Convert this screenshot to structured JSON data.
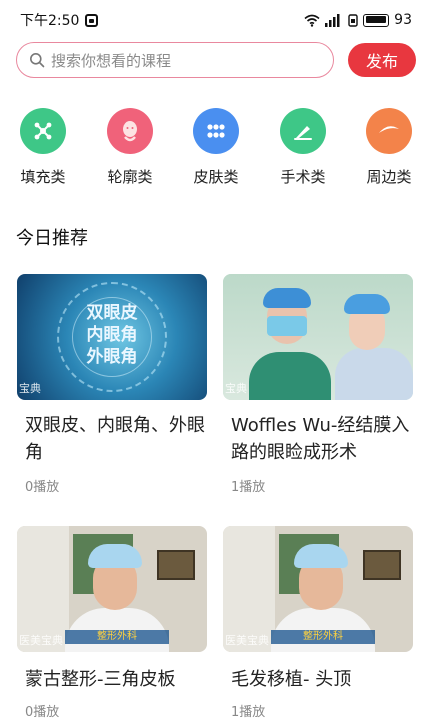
{
  "status_bar": {
    "time": "下午2:50",
    "battery": "93"
  },
  "search": {
    "placeholder": "搜索你想看的课程",
    "publish_label": "发布"
  },
  "categories": [
    {
      "label": "填充类",
      "icon": "molecule-icon",
      "color": "#3ec787"
    },
    {
      "label": "轮廓类",
      "icon": "face-icon",
      "color": "#f0627a"
    },
    {
      "label": "皮肤类",
      "icon": "dots-grid-icon",
      "color": "#4a8ff0"
    },
    {
      "label": "手术类",
      "icon": "scalpel-icon",
      "color": "#3ec787"
    },
    {
      "label": "周边类",
      "icon": "eyebrow-icon",
      "color": "#f3834a"
    }
  ],
  "section_title": "今日推荐",
  "courses": [
    {
      "title": "双眼皮、内眼角、外眼角",
      "plays": "0播放",
      "thumb_text": [
        "双眼皮",
        "内眼角",
        "外眼角"
      ],
      "watermark": "宝典"
    },
    {
      "title": "Woffles Wu-经结膜入路的眼睑成形术",
      "plays": "1播放",
      "watermark": "宝典"
    },
    {
      "title": "蒙古整形-三角皮板",
      "plays": "0播放",
      "watermark": "医美宝典",
      "banner": "整形外科"
    },
    {
      "title": "毛发移植- 头顶",
      "plays": "1播放",
      "watermark": "医美宝典",
      "banner": "整形外科"
    }
  ],
  "colors": {
    "accent": "#e8373f",
    "search_border": "#e9889e"
  }
}
